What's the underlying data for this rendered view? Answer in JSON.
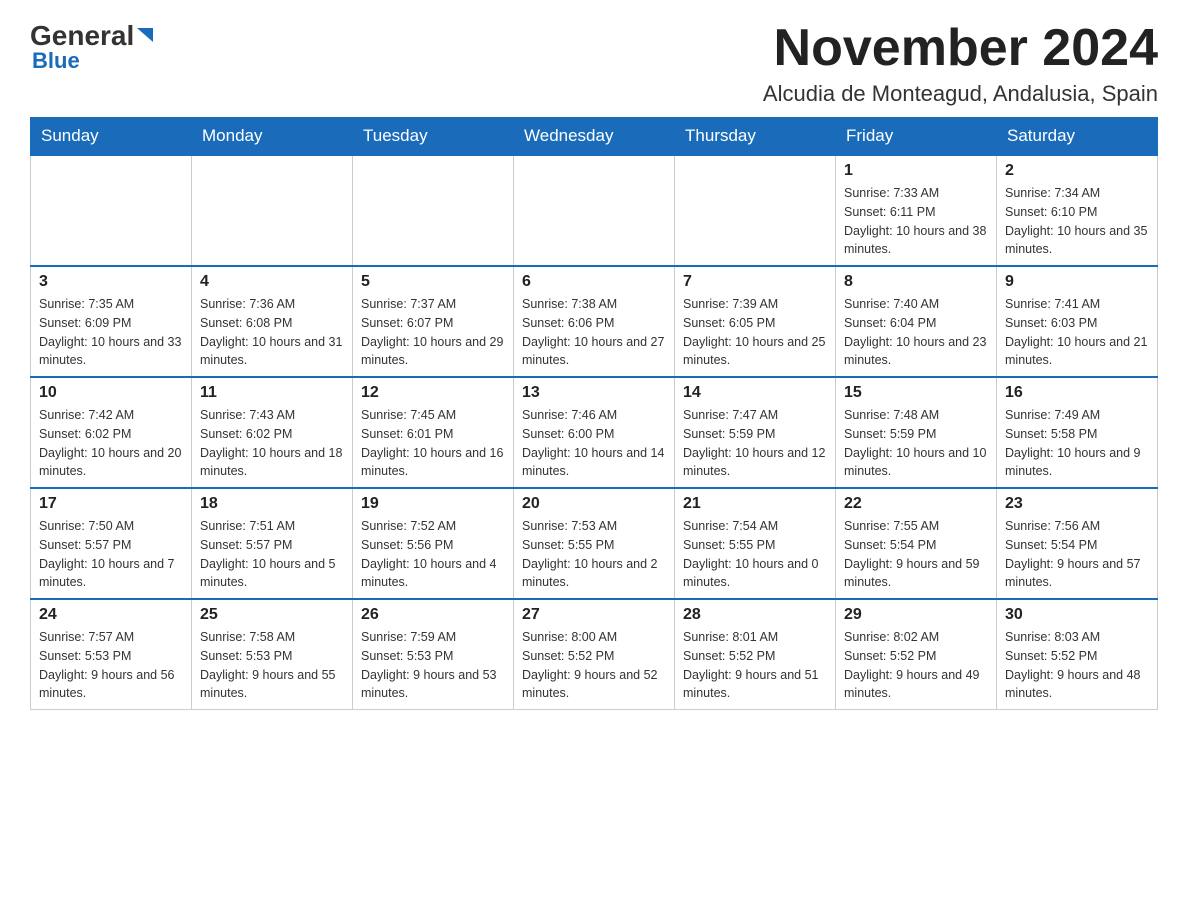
{
  "header": {
    "logo_general": "General",
    "logo_blue": "Blue",
    "month_title": "November 2024",
    "location": "Alcudia de Monteagud, Andalusia, Spain"
  },
  "weekdays": [
    "Sunday",
    "Monday",
    "Tuesday",
    "Wednesday",
    "Thursday",
    "Friday",
    "Saturday"
  ],
  "weeks": [
    [
      null,
      null,
      null,
      null,
      null,
      {
        "day": "1",
        "sunrise": "Sunrise: 7:33 AM",
        "sunset": "Sunset: 6:11 PM",
        "daylight": "Daylight: 10 hours and 38 minutes."
      },
      {
        "day": "2",
        "sunrise": "Sunrise: 7:34 AM",
        "sunset": "Sunset: 6:10 PM",
        "daylight": "Daylight: 10 hours and 35 minutes."
      }
    ],
    [
      {
        "day": "3",
        "sunrise": "Sunrise: 7:35 AM",
        "sunset": "Sunset: 6:09 PM",
        "daylight": "Daylight: 10 hours and 33 minutes."
      },
      {
        "day": "4",
        "sunrise": "Sunrise: 7:36 AM",
        "sunset": "Sunset: 6:08 PM",
        "daylight": "Daylight: 10 hours and 31 minutes."
      },
      {
        "day": "5",
        "sunrise": "Sunrise: 7:37 AM",
        "sunset": "Sunset: 6:07 PM",
        "daylight": "Daylight: 10 hours and 29 minutes."
      },
      {
        "day": "6",
        "sunrise": "Sunrise: 7:38 AM",
        "sunset": "Sunset: 6:06 PM",
        "daylight": "Daylight: 10 hours and 27 minutes."
      },
      {
        "day": "7",
        "sunrise": "Sunrise: 7:39 AM",
        "sunset": "Sunset: 6:05 PM",
        "daylight": "Daylight: 10 hours and 25 minutes."
      },
      {
        "day": "8",
        "sunrise": "Sunrise: 7:40 AM",
        "sunset": "Sunset: 6:04 PM",
        "daylight": "Daylight: 10 hours and 23 minutes."
      },
      {
        "day": "9",
        "sunrise": "Sunrise: 7:41 AM",
        "sunset": "Sunset: 6:03 PM",
        "daylight": "Daylight: 10 hours and 21 minutes."
      }
    ],
    [
      {
        "day": "10",
        "sunrise": "Sunrise: 7:42 AM",
        "sunset": "Sunset: 6:02 PM",
        "daylight": "Daylight: 10 hours and 20 minutes."
      },
      {
        "day": "11",
        "sunrise": "Sunrise: 7:43 AM",
        "sunset": "Sunset: 6:02 PM",
        "daylight": "Daylight: 10 hours and 18 minutes."
      },
      {
        "day": "12",
        "sunrise": "Sunrise: 7:45 AM",
        "sunset": "Sunset: 6:01 PM",
        "daylight": "Daylight: 10 hours and 16 minutes."
      },
      {
        "day": "13",
        "sunrise": "Sunrise: 7:46 AM",
        "sunset": "Sunset: 6:00 PM",
        "daylight": "Daylight: 10 hours and 14 minutes."
      },
      {
        "day": "14",
        "sunrise": "Sunrise: 7:47 AM",
        "sunset": "Sunset: 5:59 PM",
        "daylight": "Daylight: 10 hours and 12 minutes."
      },
      {
        "day": "15",
        "sunrise": "Sunrise: 7:48 AM",
        "sunset": "Sunset: 5:59 PM",
        "daylight": "Daylight: 10 hours and 10 minutes."
      },
      {
        "day": "16",
        "sunrise": "Sunrise: 7:49 AM",
        "sunset": "Sunset: 5:58 PM",
        "daylight": "Daylight: 10 hours and 9 minutes."
      }
    ],
    [
      {
        "day": "17",
        "sunrise": "Sunrise: 7:50 AM",
        "sunset": "Sunset: 5:57 PM",
        "daylight": "Daylight: 10 hours and 7 minutes."
      },
      {
        "day": "18",
        "sunrise": "Sunrise: 7:51 AM",
        "sunset": "Sunset: 5:57 PM",
        "daylight": "Daylight: 10 hours and 5 minutes."
      },
      {
        "day": "19",
        "sunrise": "Sunrise: 7:52 AM",
        "sunset": "Sunset: 5:56 PM",
        "daylight": "Daylight: 10 hours and 4 minutes."
      },
      {
        "day": "20",
        "sunrise": "Sunrise: 7:53 AM",
        "sunset": "Sunset: 5:55 PM",
        "daylight": "Daylight: 10 hours and 2 minutes."
      },
      {
        "day": "21",
        "sunrise": "Sunrise: 7:54 AM",
        "sunset": "Sunset: 5:55 PM",
        "daylight": "Daylight: 10 hours and 0 minutes."
      },
      {
        "day": "22",
        "sunrise": "Sunrise: 7:55 AM",
        "sunset": "Sunset: 5:54 PM",
        "daylight": "Daylight: 9 hours and 59 minutes."
      },
      {
        "day": "23",
        "sunrise": "Sunrise: 7:56 AM",
        "sunset": "Sunset: 5:54 PM",
        "daylight": "Daylight: 9 hours and 57 minutes."
      }
    ],
    [
      {
        "day": "24",
        "sunrise": "Sunrise: 7:57 AM",
        "sunset": "Sunset: 5:53 PM",
        "daylight": "Daylight: 9 hours and 56 minutes."
      },
      {
        "day": "25",
        "sunrise": "Sunrise: 7:58 AM",
        "sunset": "Sunset: 5:53 PM",
        "daylight": "Daylight: 9 hours and 55 minutes."
      },
      {
        "day": "26",
        "sunrise": "Sunrise: 7:59 AM",
        "sunset": "Sunset: 5:53 PM",
        "daylight": "Daylight: 9 hours and 53 minutes."
      },
      {
        "day": "27",
        "sunrise": "Sunrise: 8:00 AM",
        "sunset": "Sunset: 5:52 PM",
        "daylight": "Daylight: 9 hours and 52 minutes."
      },
      {
        "day": "28",
        "sunrise": "Sunrise: 8:01 AM",
        "sunset": "Sunset: 5:52 PM",
        "daylight": "Daylight: 9 hours and 51 minutes."
      },
      {
        "day": "29",
        "sunrise": "Sunrise: 8:02 AM",
        "sunset": "Sunset: 5:52 PM",
        "daylight": "Daylight: 9 hours and 49 minutes."
      },
      {
        "day": "30",
        "sunrise": "Sunrise: 8:03 AM",
        "sunset": "Sunset: 5:52 PM",
        "daylight": "Daylight: 9 hours and 48 minutes."
      }
    ]
  ]
}
